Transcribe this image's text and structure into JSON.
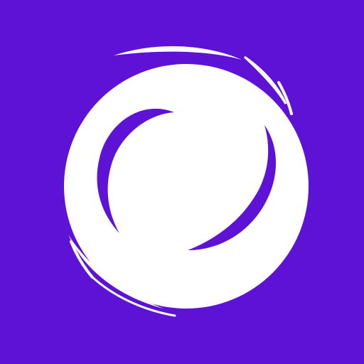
{
  "icon": {
    "name": "swirl-logo-icon",
    "colors": {
      "background": "#5E12D6",
      "foreground": "#FFFFFF"
    }
  }
}
